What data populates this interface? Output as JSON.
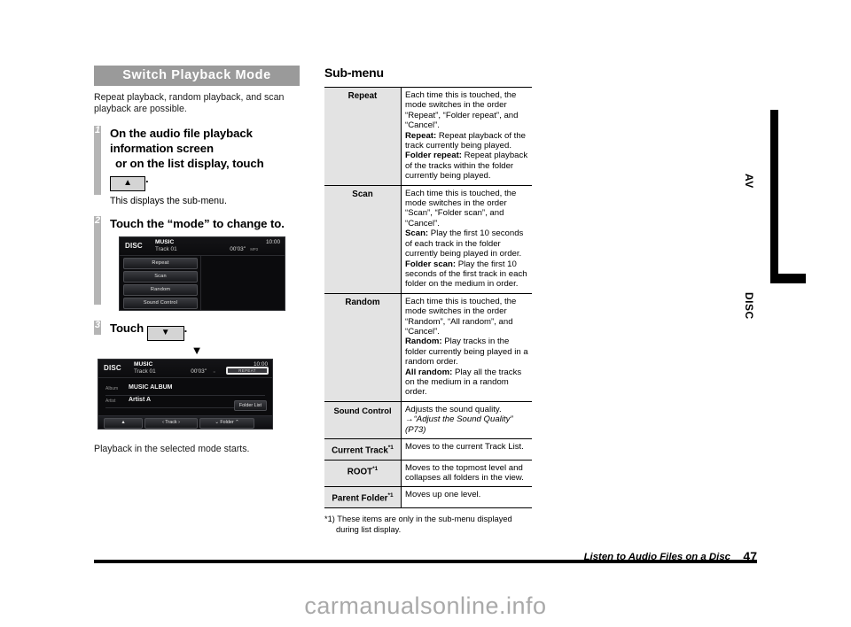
{
  "section": {
    "banner": "Switch Playback Mode",
    "intro": "Repeat playback, random playback, and scan playback are possible."
  },
  "steps": [
    {
      "num": "1",
      "title_line1": "On the audio file playback",
      "title_line2": "information screen",
      "title_line3": "or on the list display, touch",
      "keycap": "▲",
      "period": ".",
      "sub": "This displays the sub-menu."
    },
    {
      "num": "2",
      "title_line1": "Touch the “mode” to change to."
    },
    {
      "num": "3",
      "title_prefix": "Touch",
      "keycap": "▼",
      "period": "."
    }
  ],
  "result_text": "Playback in the selected mode starts.",
  "flow_arrow": "▼",
  "device1": {
    "source": "DISC",
    "title": "MUSIC",
    "track": "Track 01",
    "clock": "10:00",
    "elapsed": "00'03\"",
    "format": "MP3",
    "buttons": [
      "Repeat",
      "Scan",
      "Random",
      "Sound Control"
    ],
    "scroll_down": "▼"
  },
  "device2": {
    "source": "DISC",
    "title": "MUSIC",
    "track": "Track 01",
    "clock": "10:00",
    "elapsed": "00'03\"",
    "format": "=",
    "repeat_badge": "REPEAT",
    "album_label": "Album",
    "album_value": "MUSIC ALBUM",
    "artist_label": "Artist",
    "artist_value": "Artist A",
    "folder_list": "Folder List",
    "bottom_up": "▲",
    "bottom_track": "‹  Track  ›",
    "bottom_folder": "⌄  Folder  ⌃"
  },
  "submenu": {
    "heading": "Sub-menu",
    "rows": [
      {
        "key": "Repeat",
        "key_sup": "",
        "lines": [
          {
            "text": "Each time this is touched, the mode switches in the order “Repeat”, “Folder repeat”, and “Cancel”."
          },
          {
            "bold": "Repeat:",
            "text": "  Repeat playback of the track currently being played."
          },
          {
            "bold": "Folder repeat:",
            "text": "  Repeat playback of the tracks within the folder currently being played."
          }
        ]
      },
      {
        "key": "Scan",
        "key_sup": "",
        "lines": [
          {
            "text": "Each time this is touched, the mode switches in the order “Scan”, “Folder scan”, and “Cancel”."
          },
          {
            "bold": "Scan:",
            "text": "  Play the first 10 seconds of each track in the folder currently being played in order."
          },
          {
            "bold": "Folder scan:",
            "text": "  Play the first 10 seconds of the first track in each folder on the medium in order."
          }
        ]
      },
      {
        "key": "Random",
        "key_sup": "",
        "lines": [
          {
            "text": "Each time this is touched, the mode switches in the order “Random”, “All random”, and “Cancel”."
          },
          {
            "bold": "Random:",
            "text": "  Play tracks in the folder currently being played in a random order."
          },
          {
            "bold": "All random:",
            "text": "  Play all the tracks on the medium in a random order."
          }
        ]
      },
      {
        "key": "Sound Control",
        "key_sup": "",
        "lines": [
          {
            "text": "Adjusts the sound quality."
          },
          {
            "italic": "→“Adjust the Sound Quality” (P73)"
          }
        ]
      },
      {
        "key": "Current Track",
        "key_sup": "*1",
        "lines": [
          {
            "text": "Moves to the current Track List."
          }
        ]
      },
      {
        "key": "ROOT",
        "key_sup": "*1",
        "lines": [
          {
            "text": "Moves to the topmost level and collapses all folders in the view."
          }
        ]
      },
      {
        "key": "Parent Folder",
        "key_sup": "*1",
        "lines": [
          {
            "text": "Moves up one level."
          }
        ]
      }
    ],
    "footnote_line1": "*1) These items are only in the sub-menu displayed",
    "footnote_line2": "during list display."
  },
  "tabs": {
    "av": "AV",
    "disc": "DISC"
  },
  "footer": {
    "title": "Listen to Audio Files on a Disc",
    "page": "47"
  },
  "watermark": "carmanualsonline.info"
}
